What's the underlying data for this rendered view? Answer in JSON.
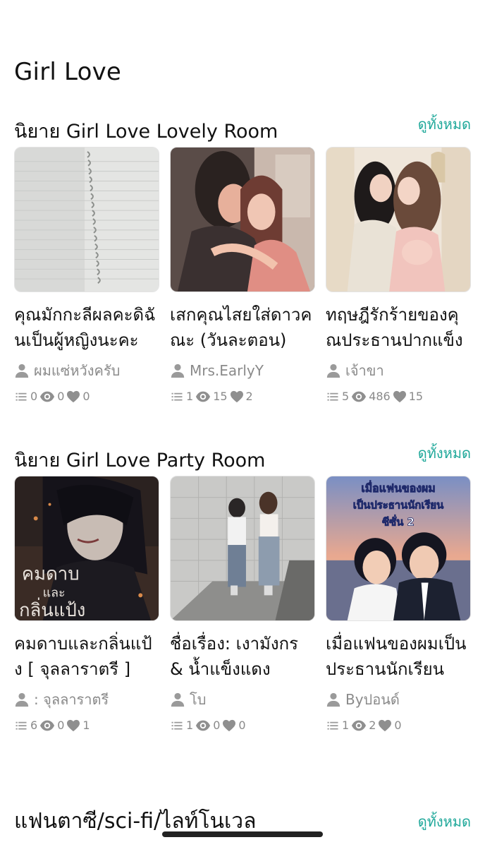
{
  "page": {
    "title": "Girl Love"
  },
  "colors": {
    "accent": "#1fa89a",
    "muted": "#8a8a8a",
    "text": "#111111"
  },
  "icons": {
    "author": "user-icon",
    "episodes": "list-icon",
    "views": "eye-icon",
    "likes": "heart-icon"
  },
  "sections": [
    {
      "title": "นิยาย Girl Love Lovely Room",
      "see_all": "ดูทั้งหมด",
      "cards": [
        {
          "title": "คุณมักกะลีผลคะดิฉันเป็นผู้หญิงนะคะ",
          "author": "ผมแซ่หวังครับ",
          "episodes": "0",
          "views": "0",
          "likes": "0"
        },
        {
          "title": "เสกคุณไสยใส่ดาวคณะ (วันละตอน)",
          "author": "Mrs.EarlyY",
          "episodes": "1",
          "views": "15",
          "likes": "2"
        },
        {
          "title": "ทฤษฎีรักร้ายของคุณประธานปากแข็ง",
          "author": "เจ้าขา",
          "episodes": "5",
          "views": "486",
          "likes": "15"
        }
      ]
    },
    {
      "title": "นิยาย Girl Love Party Room",
      "see_all": "ดูทั้งหมด",
      "cards": [
        {
          "title": "คมดาบและกลิ่นแป้ง [ จุลลาราตรี ]",
          "author": ": จุลลาราตรี",
          "episodes": "6",
          "views": "0",
          "likes": "1",
          "cover_text": "คมดาบ และ กลิ่นแป้ง"
        },
        {
          "title": "ชื่อเรื่อง: เงามังกร & น้ำแข็งแดง",
          "author": "โบ",
          "episodes": "1",
          "views": "0",
          "likes": "0"
        },
        {
          "title": "เมื่อแฟนของผมเป็นประธานนักเรียน",
          "author": "Byปอนด์",
          "episodes": "1",
          "views": "2",
          "likes": "0",
          "cover_text_1": "เมื่อแฟนของผม",
          "cover_text_2": "เป็นประธานนักเรียน",
          "cover_text_3": "ซีซั่น 2"
        }
      ]
    }
  ],
  "next_section": {
    "title": "แฟนตาซี/sci-fi/ไลท์โนเวล",
    "see_all": "ดูทั้งหมด"
  }
}
